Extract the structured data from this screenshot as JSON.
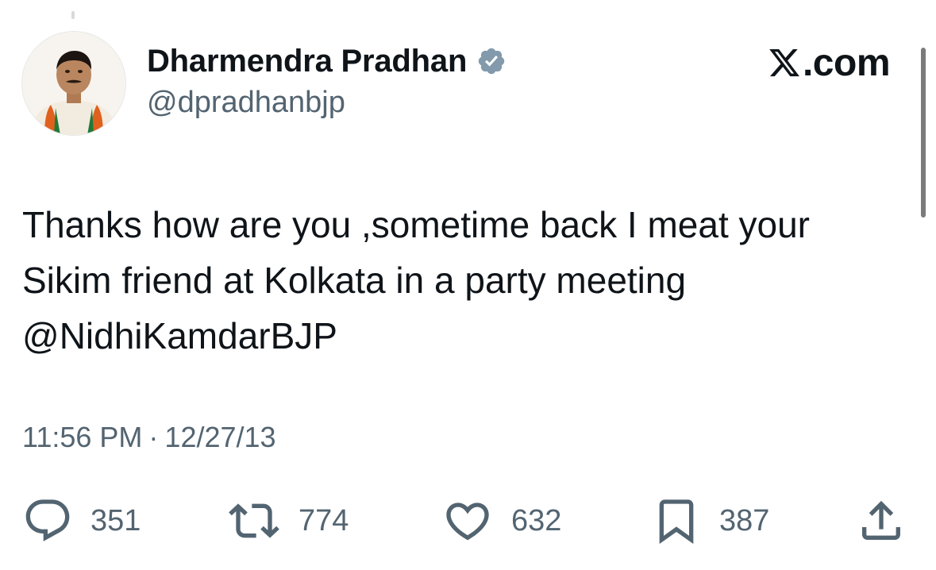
{
  "author": {
    "name": "Dharmendra Pradhan",
    "handle": "@dpradhanbjp",
    "verified": true,
    "verified_color": "#829aab"
  },
  "brand": {
    "text": ".com",
    "icon": "x-logo-icon"
  },
  "tweet": {
    "lines": [
      "Thanks how are you ,sometime back I meat your",
      "Sikim friend at Kolkata in a party meeting",
      "@NidhiKamdarBJP"
    ]
  },
  "meta": {
    "time": "11:56 PM",
    "separator": "·",
    "date": "12/27/13"
  },
  "actions": {
    "replies": {
      "icon": "reply-icon",
      "count": "351"
    },
    "reposts": {
      "icon": "repost-icon",
      "count": "774"
    },
    "likes": {
      "icon": "heart-icon",
      "count": "632"
    },
    "bookmarks": {
      "icon": "bookmark-icon",
      "count": "387"
    },
    "share": {
      "icon": "share-icon"
    }
  },
  "colors": {
    "text_primary": "#0f1419",
    "text_secondary": "#536471",
    "background": "#ffffff"
  }
}
